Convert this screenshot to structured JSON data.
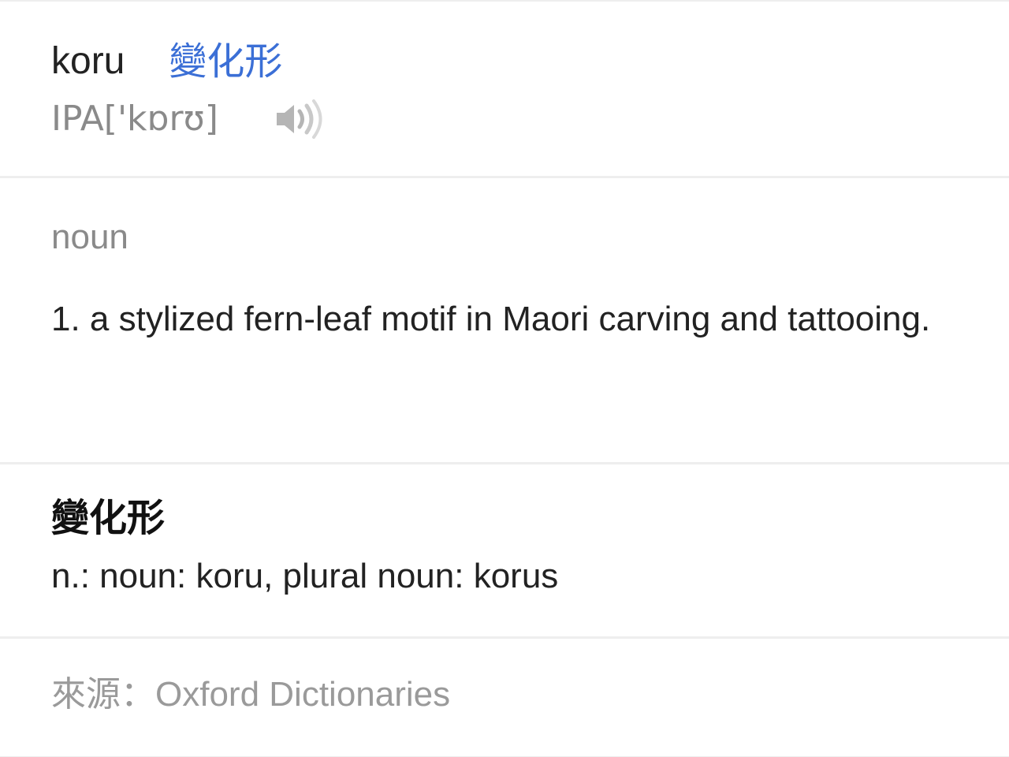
{
  "entry": {
    "headword": "koru",
    "forms_link_label": "變化形",
    "ipa": "IPA['kɒrʊ]",
    "speaker_icon": "speaker-volume-icon"
  },
  "definition_section": {
    "part_of_speech": "noun",
    "definition": "1. a stylized fern-leaf motif in Maori carving and tattooing."
  },
  "forms_section": {
    "title": "變化形",
    "text": "n.: noun: koru, plural noun: korus"
  },
  "source_section": {
    "prefix": "來源：",
    "name": "Oxford Dictionaries"
  },
  "colors": {
    "link": "#3b6fd6",
    "muted": "#8a8a8a",
    "divider": "#eeeeee",
    "text": "#222222"
  }
}
